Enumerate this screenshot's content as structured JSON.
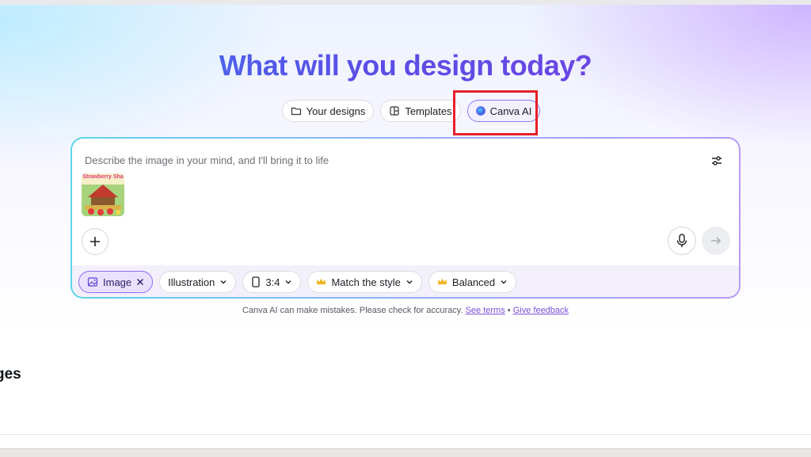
{
  "hero": {
    "title": "What will you design today?"
  },
  "tabs": [
    {
      "label": "Your designs",
      "icon": "folder-icon"
    },
    {
      "label": "Templates",
      "icon": "template-icon"
    },
    {
      "label": "Canva AI",
      "icon": "canva-ai-icon",
      "active": true
    }
  ],
  "prompt": {
    "placeholder": "Describe the image in your mind, and I'll bring it to life",
    "attachment_title": "Strawberry Sha"
  },
  "chips": [
    {
      "label": "Image",
      "icon": "image-icon",
      "selected": true,
      "removable": true
    },
    {
      "label": "Illustration",
      "dropdown": true
    },
    {
      "label": "3:4",
      "icon": "portrait-icon",
      "dropdown": true
    },
    {
      "label": "Match the style",
      "icon": "crown-icon",
      "dropdown": true
    },
    {
      "label": "Balanced",
      "icon": "crown-icon",
      "dropdown": true
    }
  ],
  "disclaimer": {
    "text": "Canva AI can make mistakes. Please check for accuracy.",
    "terms_link": "See terms",
    "separator": "•",
    "feedback_link": "Give feedback"
  },
  "section": {
    "title": "ges"
  },
  "colors": {
    "accent": "#8b6cf0",
    "highlight": "#e5202b",
    "title_gradient_start": "#3d7cf0",
    "title_gradient_end": "#7b3fe0"
  }
}
